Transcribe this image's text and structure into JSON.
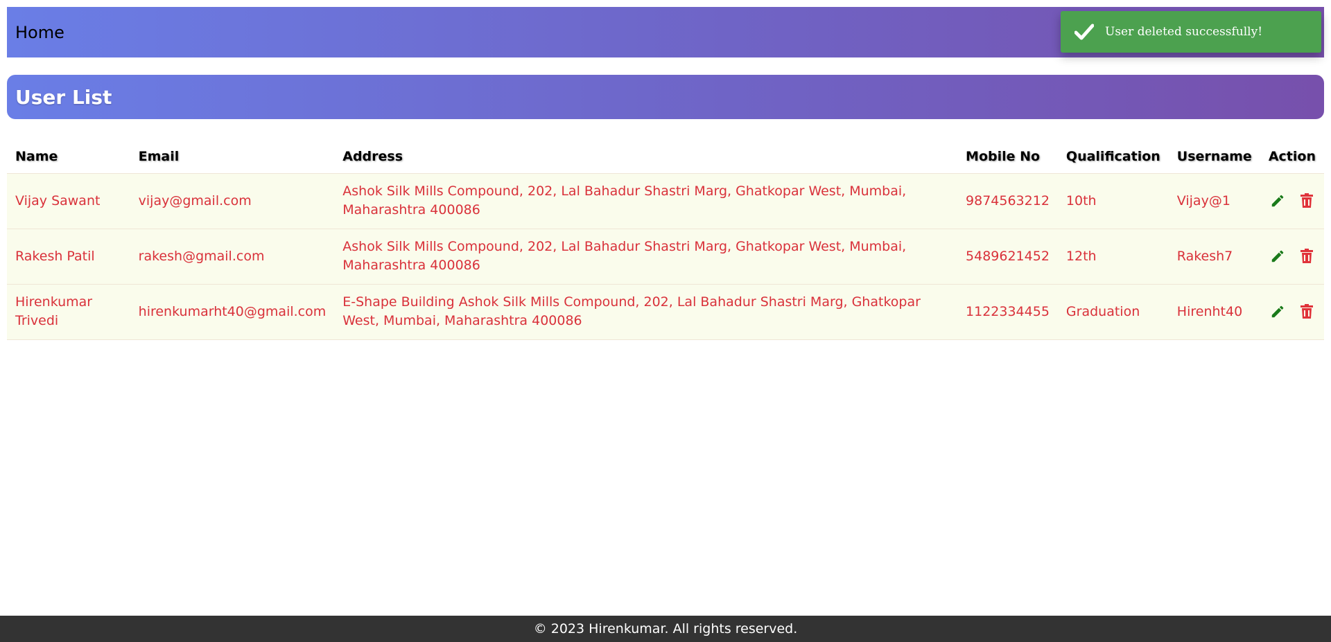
{
  "navbar": {
    "home_label": "Home"
  },
  "toast": {
    "message": "User deleted successfully!",
    "icon": "check-icon",
    "color": "#4ca14f"
  },
  "page": {
    "title": "User List"
  },
  "table": {
    "headers": {
      "name": "Name",
      "email": "Email",
      "address": "Address",
      "mobile": "Mobile No",
      "qualification": "Qualification",
      "username": "Username",
      "action": "Action"
    },
    "rows": [
      {
        "name": "Vijay Sawant",
        "email": "vijay@gmail.com",
        "address": "Ashok Silk Mills Compound, 202, Lal Bahadur Shastri Marg, Ghatkopar West, Mumbai, Maharashtra 400086",
        "mobile": "9874563212",
        "qualification": "10th",
        "username": "Vijay@1"
      },
      {
        "name": "Rakesh Patil",
        "email": "rakesh@gmail.com",
        "address": "Ashok Silk Mills Compound, 202, Lal Bahadur Shastri Marg, Ghatkopar West, Mumbai, Maharashtra 400086",
        "mobile": "5489621452",
        "qualification": "12th",
        "username": "Rakesh7"
      },
      {
        "name": "Hirenkumar Trivedi",
        "email": "hirenkumarht40@gmail.com",
        "address": "E-Shape Building Ashok Silk Mills Compound, 202, Lal Bahadur Shastri Marg, Ghatkopar West, Mumbai, Maharashtra 400086",
        "mobile": "1122334455",
        "qualification": "Graduation",
        "username": "Hirenht40"
      }
    ],
    "action_icons": {
      "edit": "pencil-icon",
      "delete": "trash-icon"
    }
  },
  "footer": {
    "text": "© 2023 Hirenkumar. All rights reserved."
  },
  "colors": {
    "gradient_start": "#6a7ee6",
    "gradient_end": "#7750ac",
    "cell_text": "#d9313a",
    "row_bg": "#fafcec",
    "edit_icon": "#1a7a1a",
    "delete_icon": "#e0323a",
    "footer_bg": "#333333"
  }
}
